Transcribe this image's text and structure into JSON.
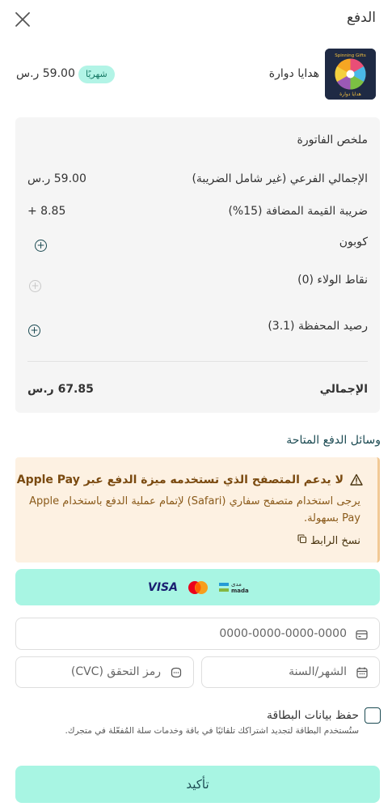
{
  "header": {
    "title": "الدفع"
  },
  "product": {
    "name": "هدايا دوارة",
    "badge": "شهريًا",
    "price": "59.00 ر.س",
    "logo_text_top": "Spinning Gifts",
    "logo_text_bottom": "هدايا دوارة"
  },
  "summary": {
    "title": "ملخص الفاتورة",
    "subtotal_label": "الإجمالي الفرعي (غير شامل الضريبة)",
    "subtotal_value": "59.00 ر.س",
    "vat_label": "ضريبة القيمة المضافة (15%)",
    "vat_value": "+ 8.85",
    "coupon_label": "كوبون",
    "loyalty_label": "نقاط الولاء (0)",
    "wallet_label": "رصيد المحفظة (3.1)",
    "total_label": "الإجمالي",
    "total_value": "67.85 ر.س"
  },
  "payment": {
    "section_title": "وسائل الدفع المتاحة",
    "warning_title": "لا يدعم المتصفح الذي تستخدمه ميزة الدفع عبر Apple Pay",
    "warning_body": "يرجى استخدام متصفح سفاري (Safari) لإتمام عملية الدفع باستخدام Apple Pay بسهولة.",
    "copy_link": "نسخ الرابط",
    "card_brands": [
      "mada",
      "mastercard",
      "VISA"
    ],
    "card_number_placeholder": "0000-0000-0000-0000",
    "expiry_placeholder": "الشهر/السنة",
    "cvc_placeholder": "رمز التحقق (CVC)",
    "save_card_label": "حفظ بيانات البطاقة",
    "save_card_note": "ستُستخدم البطاقة لتجديد اشتراكك تلقائيًا في باقة وخدمات سلة المُفعّلة في متجرك.",
    "confirm_label": "تأكيد"
  },
  "colors": {
    "accent": "#a8f5e3",
    "accent_dark": "#1b4a52",
    "warning_bg": "#fdf1e2",
    "summary_bg": "#f5f5f5"
  }
}
